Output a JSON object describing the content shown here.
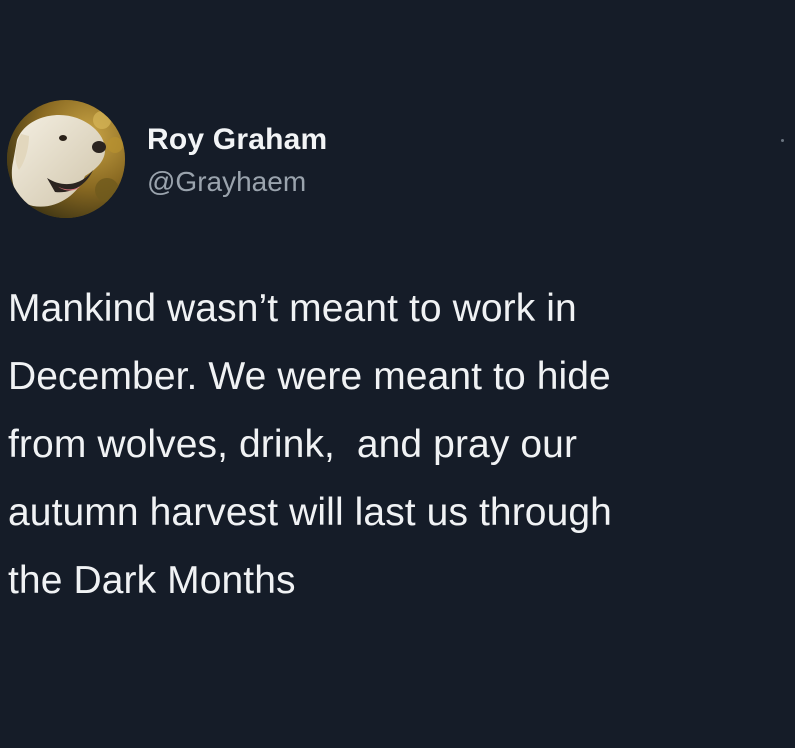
{
  "tweet": {
    "author": {
      "display_name": "Roy Graham",
      "handle": "@Grayhaem",
      "avatar_icon": "dog-avatar"
    },
    "text": "Mankind wasn’t meant to work in\nDecember. We were meant to hide\nfrom wolves, drink,  and pray our\nautumn harvest will last us through\nthe Dark Months"
  },
  "colors": {
    "background": "#151c28",
    "name": "#f2f4f6",
    "handle": "#9aa3ad",
    "text": "#f0f2f4"
  }
}
